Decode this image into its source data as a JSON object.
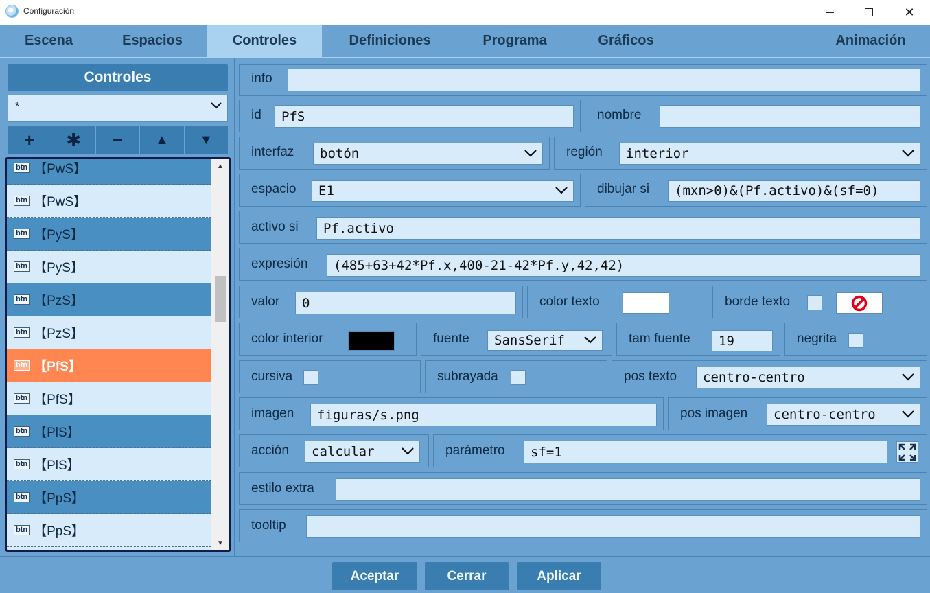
{
  "window": {
    "title": "Configuración"
  },
  "tabs": [
    {
      "label": "Escena"
    },
    {
      "label": "Espacios"
    },
    {
      "label": "Controles"
    },
    {
      "label": "Definiciones"
    },
    {
      "label": "Programa"
    },
    {
      "label": "Gráficos"
    },
    {
      "label": "Animación"
    }
  ],
  "active_tab": "Controles",
  "sidebar": {
    "header": "Controles",
    "filter_value": "*",
    "tools": [
      {
        "symbol": "+",
        "icon": "add-icon"
      },
      {
        "symbol": "✱",
        "icon": "asterisk-icon"
      },
      {
        "symbol": "−",
        "icon": "remove-icon"
      },
      {
        "symbol": "▲",
        "icon": "move-up-icon"
      },
      {
        "symbol": "▼",
        "icon": "move-down-icon"
      }
    ],
    "items": [
      {
        "tag": "btn",
        "label": "【PwS】"
      },
      {
        "tag": "btn",
        "label": "【PwS】"
      },
      {
        "tag": "btn",
        "label": "【PyS】"
      },
      {
        "tag": "btn",
        "label": "【PyS】"
      },
      {
        "tag": "btn",
        "label": "【PzS】"
      },
      {
        "tag": "btn",
        "label": "【PzS】"
      },
      {
        "tag": "btn",
        "label": "【PfS】"
      },
      {
        "tag": "btn",
        "label": "【PfS】"
      },
      {
        "tag": "btn",
        "label": "【PlS】"
      },
      {
        "tag": "btn",
        "label": "【PlS】"
      },
      {
        "tag": "btn",
        "label": "【PpS】"
      },
      {
        "tag": "btn",
        "label": "【PpS】"
      }
    ],
    "selected_index": 6
  },
  "form": {
    "info": {
      "label": "info",
      "value": ""
    },
    "id": {
      "label": "id",
      "value": "PfS"
    },
    "nombre": {
      "label": "nombre",
      "value": ""
    },
    "interfaz": {
      "label": "interfaz",
      "value": "botón"
    },
    "region": {
      "label": "región",
      "value": "interior"
    },
    "espacio": {
      "label": "espacio",
      "value": "E1"
    },
    "dibujar_si": {
      "label": "dibujar si",
      "value": "(mxn>0)&(Pf.activo)&(sf=0)"
    },
    "activo_si": {
      "label": "activo si",
      "value": "Pf.activo"
    },
    "expresion": {
      "label": "expresión",
      "value": "(485+63+42*Pf.x,400-21-42*Pf.y,42,42)"
    },
    "valor": {
      "label": "valor",
      "value": "0"
    },
    "color_texto": {
      "label": "color texto",
      "color": "#ffffff"
    },
    "borde_texto": {
      "label": "borde texto",
      "checked": false
    },
    "color_interior": {
      "label": "color interior",
      "color": "#000000"
    },
    "fuente": {
      "label": "fuente",
      "value": "SansSerif"
    },
    "tam_fuente": {
      "label": "tam fuente",
      "value": "19"
    },
    "negrita": {
      "label": "negrita",
      "checked": false
    },
    "cursiva": {
      "label": "cursiva",
      "checked": false
    },
    "subrayada": {
      "label": "subrayada",
      "checked": false
    },
    "pos_texto": {
      "label": "pos texto",
      "value": "centro-centro"
    },
    "imagen": {
      "label": "imagen",
      "value": "figuras/s.png"
    },
    "pos_imagen": {
      "label": "pos imagen",
      "value": "centro-centro"
    },
    "accion": {
      "label": "acción",
      "value": "calcular"
    },
    "parametro": {
      "label": "parámetro",
      "value": "sf=1"
    },
    "estilo_extra": {
      "label": "estilo extra",
      "value": ""
    },
    "tooltip": {
      "label": "tooltip",
      "value": ""
    }
  },
  "footer": {
    "accept": "Aceptar",
    "close": "Cerrar",
    "apply": "Aplicar"
  },
  "colors": {
    "background": "#6aa3d1",
    "active_tab": "#a9d2f1",
    "dark_button": "#3a7db0",
    "list_dark": "#4a8fc1",
    "list_light": "#d7ebfb",
    "selected": "#ff8650",
    "no_icon": "#e0001a"
  }
}
